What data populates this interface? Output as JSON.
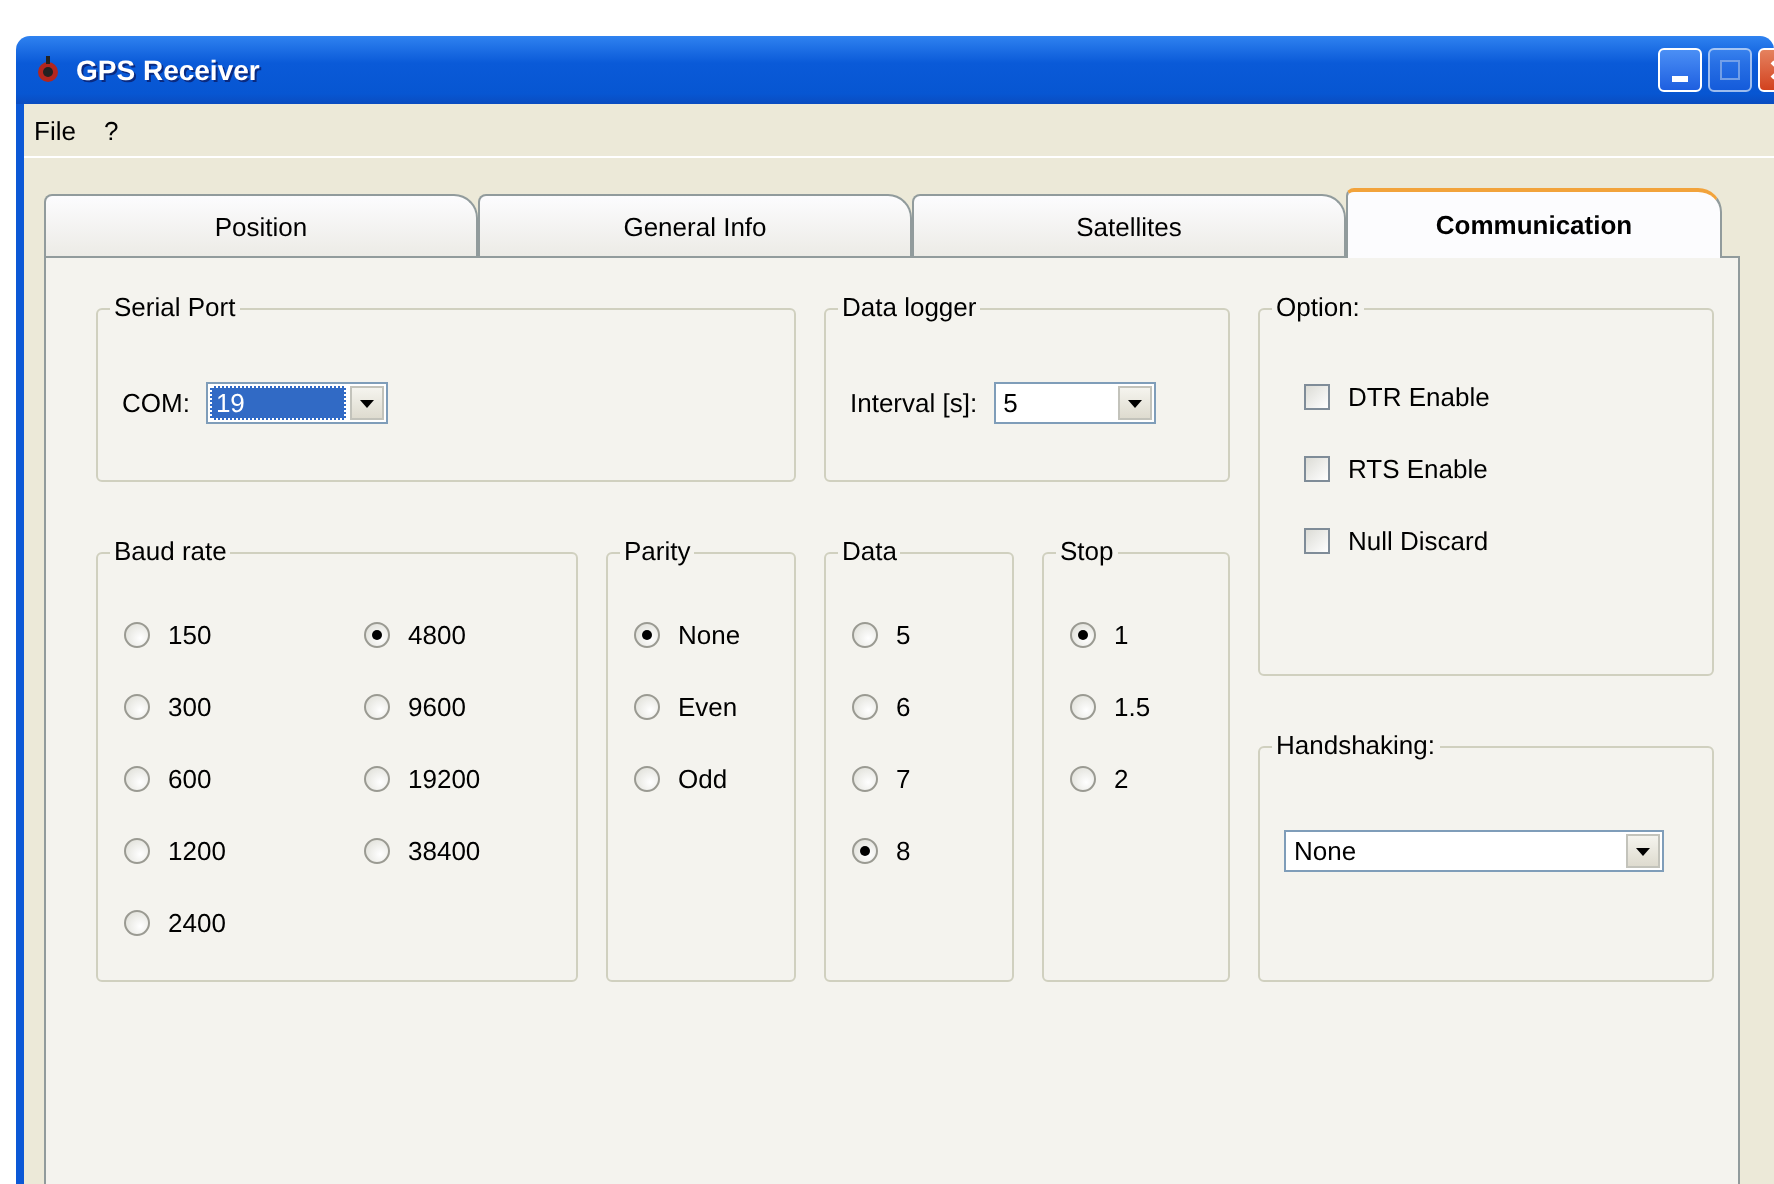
{
  "window": {
    "title": "GPS Receiver"
  },
  "menu": [
    {
      "label": "File"
    },
    {
      "label": "?"
    }
  ],
  "tabs": [
    {
      "label": "Position",
      "selected": false
    },
    {
      "label": "General Info",
      "selected": false
    },
    {
      "label": "Satellites",
      "selected": false
    },
    {
      "label": "Communication",
      "selected": true
    }
  ],
  "serial_port": {
    "title": "Serial Port",
    "label": "COM:",
    "value": "19",
    "highlighted": true
  },
  "data_logger": {
    "title": "Data logger",
    "label": "Interval [s]:",
    "value": "5",
    "highlighted": false
  },
  "option": {
    "title": "Option:",
    "checkboxes": [
      {
        "label": "DTR Enable",
        "checked": false
      },
      {
        "label": "RTS Enable",
        "checked": false
      },
      {
        "label": "Null Discard",
        "checked": false
      }
    ]
  },
  "baud_rate": {
    "title": "Baud rate",
    "options": [
      {
        "label": "150",
        "selected": false
      },
      {
        "label": "300",
        "selected": false
      },
      {
        "label": "600",
        "selected": false
      },
      {
        "label": "1200",
        "selected": false
      },
      {
        "label": "2400",
        "selected": false
      },
      {
        "label": "4800",
        "selected": true
      },
      {
        "label": "9600",
        "selected": false
      },
      {
        "label": "19200",
        "selected": false
      },
      {
        "label": "38400",
        "selected": false
      }
    ]
  },
  "parity": {
    "title": "Parity",
    "options": [
      {
        "label": "None",
        "selected": true
      },
      {
        "label": "Even",
        "selected": false
      },
      {
        "label": "Odd",
        "selected": false
      }
    ]
  },
  "data": {
    "title": "Data",
    "options": [
      {
        "label": "5",
        "selected": false
      },
      {
        "label": "6",
        "selected": false
      },
      {
        "label": "7",
        "selected": false
      },
      {
        "label": "8",
        "selected": true
      }
    ]
  },
  "stop": {
    "title": "Stop",
    "options": [
      {
        "label": "1",
        "selected": true
      },
      {
        "label": "1.5",
        "selected": false
      },
      {
        "label": "2",
        "selected": false
      }
    ]
  },
  "handshaking": {
    "title": "Handshaking:",
    "value": "None"
  }
}
